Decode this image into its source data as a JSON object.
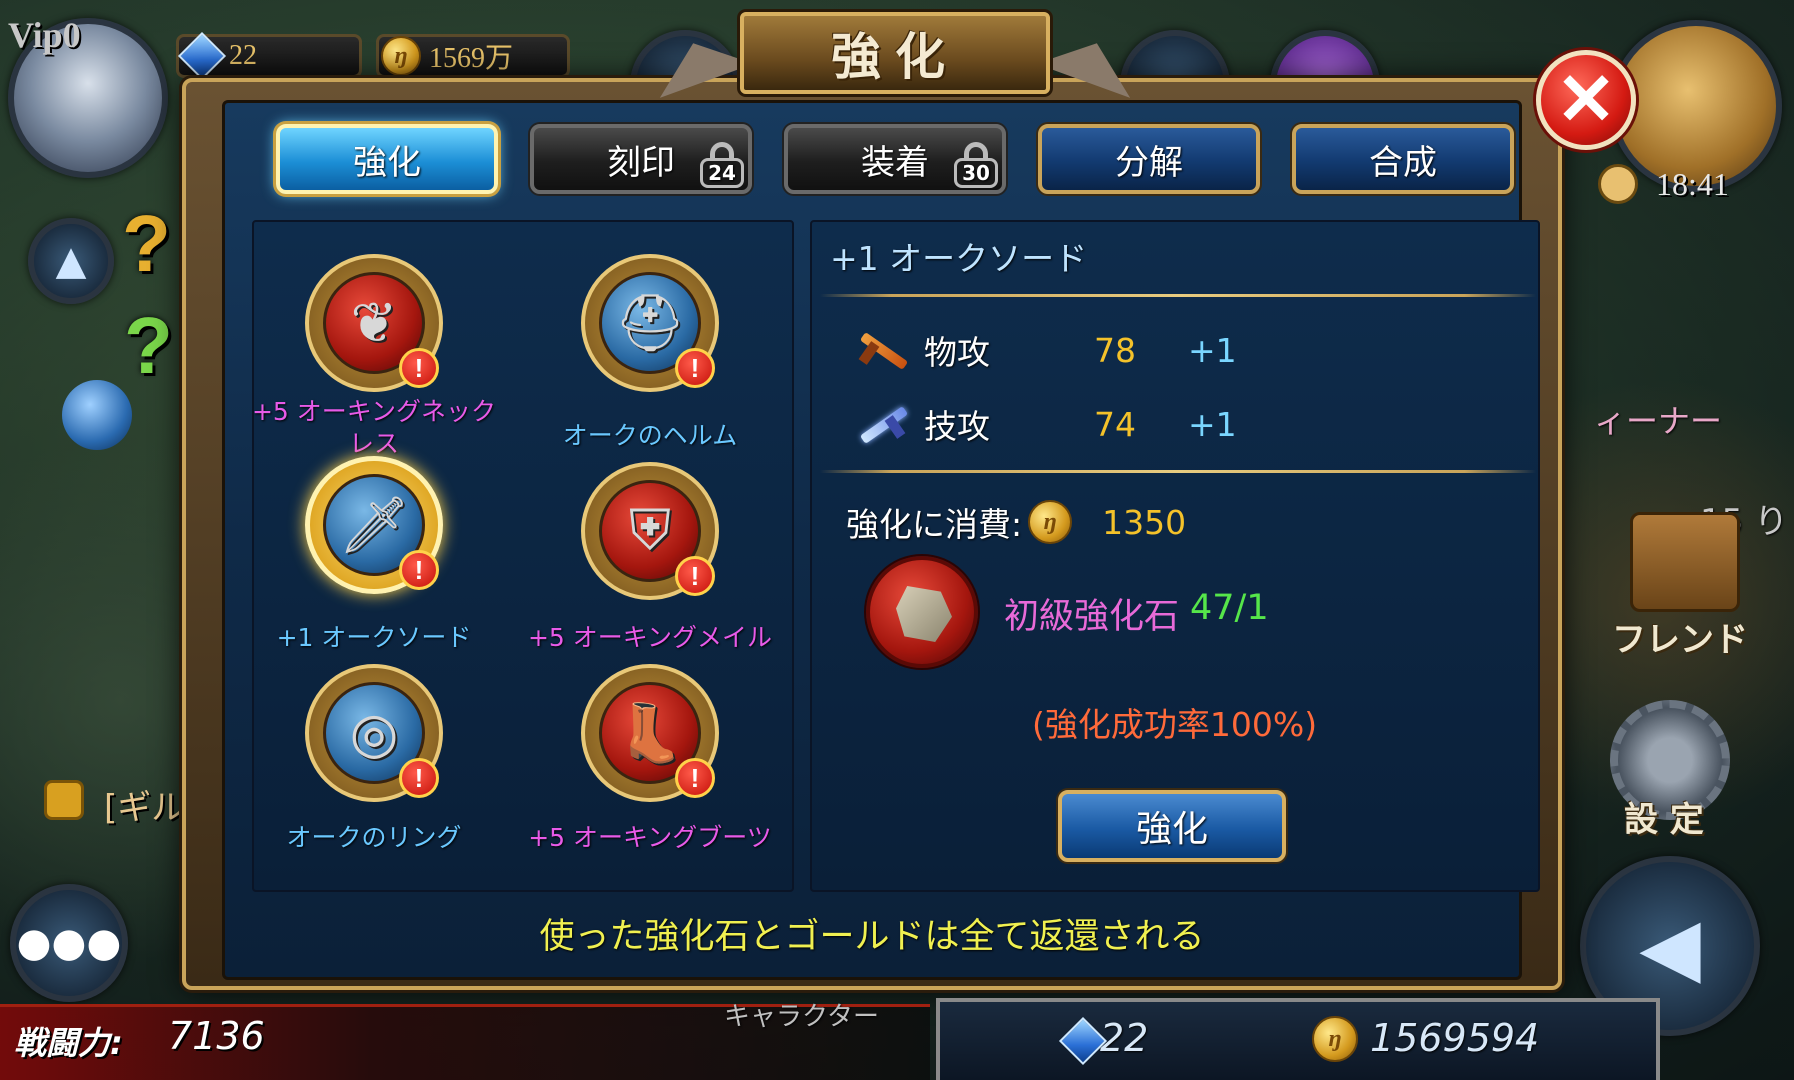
{
  "hud": {
    "vip": "Vip0",
    "gems": "22",
    "gold": "1569万",
    "time": "18:41",
    "guild_text": "[ギル",
    "colors": {
      "accent_gold": "#c9a45a",
      "panel_blue": "#0f2a48"
    }
  },
  "window": {
    "title": "強化",
    "close_icon": "close-icon"
  },
  "tabs": [
    {
      "label": "強化",
      "state": "active"
    },
    {
      "label": "刻印",
      "state": "locked",
      "lock_level": "24"
    },
    {
      "label": "装着",
      "state": "locked",
      "lock_level": "30"
    },
    {
      "label": "分解",
      "state": "normal"
    },
    {
      "label": "合成",
      "state": "normal"
    }
  ],
  "items": [
    {
      "name": "+5 オーキングネックレス",
      "color": "#e85ae8",
      "icon": "necklace-icon",
      "core": "red"
    },
    {
      "name": "オークのヘルム",
      "color": "#6ac8ff",
      "icon": "helmet-icon",
      "core": "blue"
    },
    {
      "name": "+1 オークソード",
      "color": "#6ac8ff",
      "icon": "sword-icon",
      "core": "blue",
      "selected": true
    },
    {
      "name": "+5 オーキングメイル",
      "color": "#e85ae8",
      "icon": "armor-icon",
      "core": "red"
    },
    {
      "name": "オークのリング",
      "color": "#6ac8ff",
      "icon": "ring-icon",
      "core": "blue"
    },
    {
      "name": "+5 オーキングブーツ",
      "color": "#e85ae8",
      "icon": "boots-icon",
      "core": "red"
    }
  ],
  "detail": {
    "title": "+1 オークソード",
    "stats": [
      {
        "name": "物攻",
        "value": "78",
        "bonus": "+1",
        "icon": "sword-stat-icon"
      },
      {
        "name": "技攻",
        "value": "74",
        "bonus": "+1",
        "icon": "magic-sword-stat-icon"
      }
    ],
    "cost_label": "強化に消費:",
    "cost_value": "1350",
    "material_name": "初級強化石",
    "material_count": "47/1",
    "success_rate": "(強化成功率100%)",
    "enhance_button": "強化"
  },
  "notice": "使った強化石とゴールドは全て返還される",
  "bottom": {
    "power_label": "戦闘力:",
    "power_value": "7136",
    "bar_label": "キャラクター",
    "gems": "22",
    "gold": "1569594"
  },
  "side": {
    "friend": "フレンド",
    "settings": "設 定",
    "trainer": "ィーナー",
    "level_hint": "15 り"
  }
}
